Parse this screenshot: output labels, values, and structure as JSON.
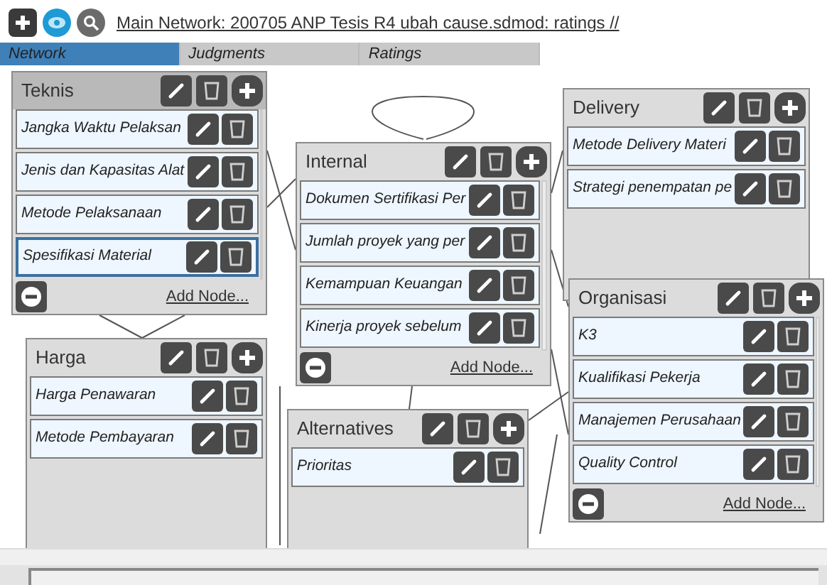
{
  "toolbar": {
    "title_link": "Main Network: 200705 ANP Tesis R4 ubah cause.sdmod: ratings //"
  },
  "tabs": [
    {
      "label": "Network",
      "selected": true
    },
    {
      "label": "Judgments",
      "selected": false
    },
    {
      "label": "Ratings",
      "selected": false
    }
  ],
  "clusters": [
    {
      "name": "Teknis",
      "add_node": "Add Node...",
      "nodes": [
        {
          "label": "Jangka Waktu Pelaksan",
          "selected": false
        },
        {
          "label": "Jenis dan Kapasitas Alat",
          "selected": false
        },
        {
          "label": "Metode Pelaksanaan",
          "selected": false
        },
        {
          "label": "Spesifikasi Material",
          "selected": true
        }
      ]
    },
    {
      "name": "Harga",
      "nodes": [
        {
          "label": "Harga Penawaran",
          "selected": false
        },
        {
          "label": "Metode Pembayaran",
          "selected": false
        }
      ]
    },
    {
      "name": "Internal",
      "add_node": "Add Node...",
      "nodes": [
        {
          "label": "Dokumen Sertifikasi Per",
          "selected": false
        },
        {
          "label": "Jumlah proyek yang per",
          "selected": false
        },
        {
          "label": "Kemampuan Keuangan",
          "selected": false
        },
        {
          "label": "Kinerja proyek sebelum",
          "selected": false
        }
      ]
    },
    {
      "name": "Alternatives",
      "nodes": [
        {
          "label": "Prioritas",
          "selected": false
        }
      ]
    },
    {
      "name": "Delivery",
      "nodes": [
        {
          "label": "Metode Delivery Materi",
          "selected": false
        },
        {
          "label": "Strategi penempatan pe",
          "selected": false
        }
      ]
    },
    {
      "name": "Organisasi",
      "add_node": "Add Node...",
      "nodes": [
        {
          "label": "K3",
          "selected": false
        },
        {
          "label": "Kualifikasi Pekerja",
          "selected": false
        },
        {
          "label": "Manajemen Perusahaan",
          "selected": false
        },
        {
          "label": "Quality Control",
          "selected": false
        }
      ]
    }
  ]
}
